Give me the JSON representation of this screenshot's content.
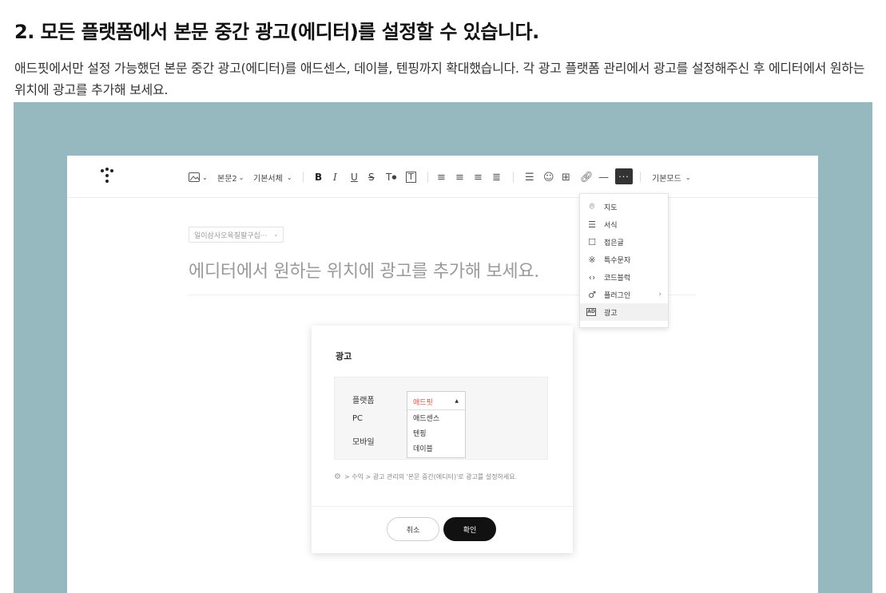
{
  "heading": "2. 모든 플랫폼에서 본문 중간 광고(에디터)를 설정할 수 있습니다.",
  "description": "애드핏에서만 설정 가능했던 본문 중간 광고(에디터)를 애드센스, 데이블, 텐핑까지 확대했습니다. 각 광고 플랫폼 관리에서 광고를 설정해주신 후 에디터에서 원하는 위치에 광고를 추가해 보세요.",
  "colors": {
    "backdrop": "#96b9bf",
    "accent_red": "#e94f38",
    "dark": "#111111"
  },
  "toolbar": {
    "image_icon": "image-icon",
    "paragraph_style": "본문2",
    "font": "기본서체",
    "bold": "B",
    "italic": "I",
    "underline": "U",
    "strike": "S",
    "text_color": "T",
    "text_bg": "T",
    "more": "···",
    "mode": "기본모드"
  },
  "editor": {
    "category_chip": "일이삼사오육칠팔구십···",
    "title_placeholder": "에디터에서 원하는 위치에 광고를 추가해 보세요."
  },
  "more_menu": {
    "items": [
      {
        "icon": "map-pin-icon",
        "label": "지도"
      },
      {
        "icon": "format-icon",
        "label": "서식"
      },
      {
        "icon": "fold-icon",
        "label": "접은글"
      },
      {
        "icon": "special-char-icon",
        "label": "특수문자"
      },
      {
        "icon": "code-icon",
        "label": "코드블럭"
      },
      {
        "icon": "plugin-icon",
        "label": "플러그인"
      },
      {
        "icon": "ad-icon",
        "label": "광고"
      }
    ]
  },
  "modal": {
    "title": "광고",
    "labels": {
      "platform": "플랫폼",
      "pc": "PC",
      "mobile": "모바일"
    },
    "select": {
      "selected": "애드핏",
      "options": [
        "애드센스",
        "텐핑",
        "데이블"
      ]
    },
    "note": "> 수익 > 광고 관리의 '본문 중간(에디터)'로 광고를 설정하세요.",
    "cancel": "취소",
    "confirm": "확인"
  }
}
